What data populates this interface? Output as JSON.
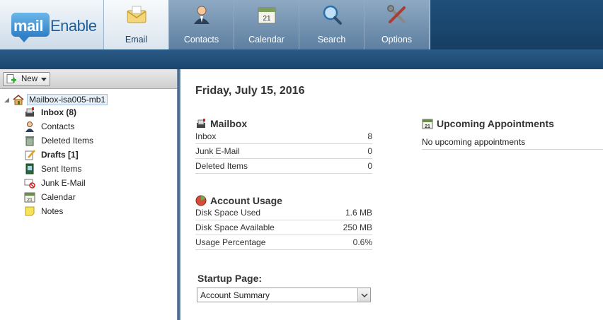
{
  "brand": {
    "logo_mail": "mail",
    "logo_enable": "Enable",
    "accent": "#1f4f7a"
  },
  "nav": {
    "tabs": [
      {
        "label": "Email",
        "icon": "envelope-icon",
        "active": true
      },
      {
        "label": "Contacts",
        "icon": "person-icon",
        "active": false
      },
      {
        "label": "Calendar",
        "icon": "calendar-icon",
        "active": false
      },
      {
        "label": "Search",
        "icon": "magnifier-icon",
        "active": false
      },
      {
        "label": "Options",
        "icon": "tools-icon",
        "active": false
      }
    ]
  },
  "sidebar": {
    "new_label": "New",
    "root_label": "Mailbox-isa005-mb1",
    "folders": [
      {
        "label": "Inbox (8)",
        "icon": "inbox-icon",
        "bold": true
      },
      {
        "label": "Contacts",
        "icon": "contact-icon",
        "bold": false
      },
      {
        "label": "Deleted Items",
        "icon": "trash-icon",
        "bold": false
      },
      {
        "label": "Drafts [1]",
        "icon": "drafts-icon",
        "bold": true
      },
      {
        "label": "Sent Items",
        "icon": "sent-icon",
        "bold": false
      },
      {
        "label": "Junk E-Mail",
        "icon": "junk-icon",
        "bold": false
      },
      {
        "label": "Calendar",
        "icon": "calendar-icon",
        "bold": false
      },
      {
        "label": "Notes",
        "icon": "notes-icon",
        "bold": false
      }
    ]
  },
  "main": {
    "date": "Friday, July 15, 2016",
    "mailbox": {
      "title": "Mailbox",
      "rows": [
        {
          "k": "Inbox",
          "v": "8"
        },
        {
          "k": "Junk E-Mail",
          "v": "0"
        },
        {
          "k": "Deleted Items",
          "v": "0"
        }
      ]
    },
    "usage": {
      "title": "Account Usage",
      "rows": [
        {
          "k": "Disk Space Used",
          "v": "1.6 MB"
        },
        {
          "k": "Disk Space Available",
          "v": "250 MB"
        },
        {
          "k": "Usage Percentage",
          "v": "0.6%"
        }
      ]
    },
    "appointments": {
      "title": "Upcoming Appointments",
      "empty_text": "No upcoming appointments"
    },
    "startup": {
      "label": "Startup Page:",
      "selected": "Account Summary"
    }
  }
}
